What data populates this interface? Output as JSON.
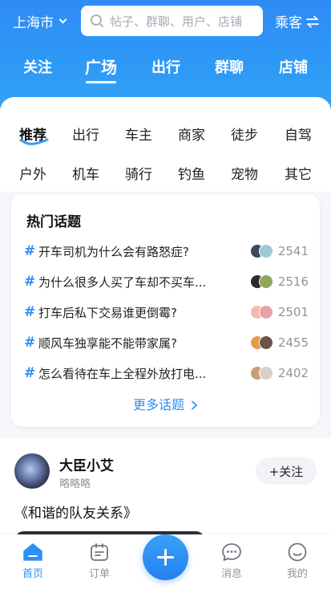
{
  "header": {
    "city": "上海市",
    "search_placeholder": "帖子、群聊、用户、店铺",
    "role_label": "乘客"
  },
  "main_tabs": [
    "关注",
    "广场",
    "出行",
    "群聊",
    "店铺"
  ],
  "active_main_tab": "广场",
  "categories_row1": [
    "推荐",
    "出行",
    "车主",
    "商家",
    "徒步",
    "自驾"
  ],
  "categories_row2": [
    "户外",
    "机车",
    "骑行",
    "钓鱼",
    "宠物",
    "其它"
  ],
  "hot_topics": {
    "title": "热门话题",
    "items": [
      {
        "text": "开车司机为什么会有路怒症?",
        "count": "2541"
      },
      {
        "text": "为什么很多人买了车却不买车...",
        "count": "2516"
      },
      {
        "text": "打车后私下交易谁更倒霉?",
        "count": "2501"
      },
      {
        "text": "顺风车独享能不能带家属?",
        "count": "2455"
      },
      {
        "text": "怎么看待在车上全程外放打电...",
        "count": "2402"
      }
    ],
    "more_label": "更多话题"
  },
  "post": {
    "author": "大臣小艾",
    "subtitle": "略略略",
    "follow_label": "+关注",
    "text": "《和谐的队友关系》"
  },
  "tabbar": {
    "home": "首页",
    "orders": "订单",
    "messages": "消息",
    "me": "我的"
  },
  "colors": {
    "accent": "#2e8ff5",
    "header_bg": "#2f8bf6"
  }
}
